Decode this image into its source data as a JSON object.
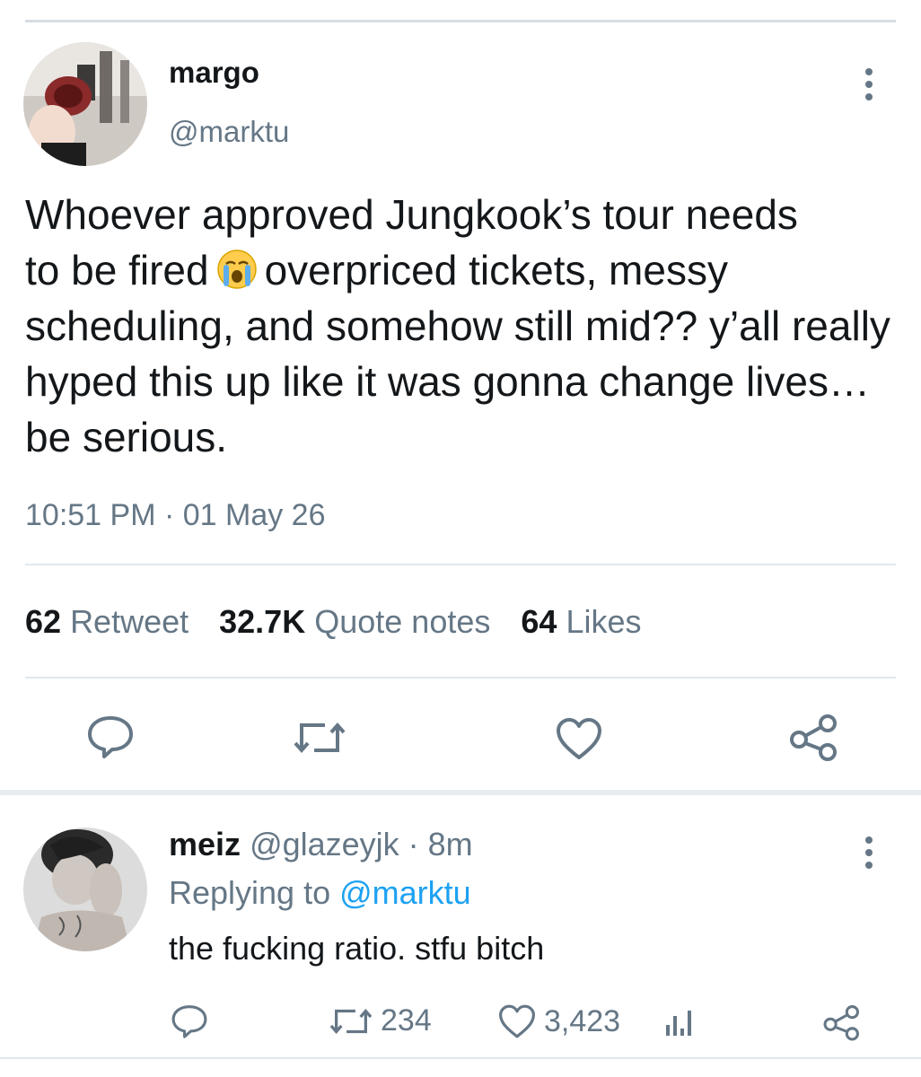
{
  "tweet": {
    "author_name": "margo",
    "author_handle": "@marktu",
    "text_line1": "Whoever approved Jungkook’s tour needs",
    "text_line2a": "to be fired",
    "text_line2b": "overpriced tickets, messy",
    "text_rest": "scheduling, and somehow still mid?? y’all really hyped this up like it was gonna change lives… be serious.",
    "emoji": "loudly-crying-face",
    "time": "10:51 PM · 01 May 26",
    "stats": {
      "retweets_count": "62",
      "retweets_label": "Retweet",
      "quotes_count": "32.7K",
      "quotes_label": "Quote notes",
      "likes_count": "64",
      "likes_label": "Likes"
    }
  },
  "reply": {
    "author_name": "meiz",
    "author_handle": "@glazeyjk · 8m",
    "replying_prefix": "Replying to",
    "replying_handle": "@marktu",
    "text": "the fucking ratio. stfu bitch",
    "retweets": "234",
    "likes": "3,423"
  },
  "colors": {
    "text": "#14171a",
    "muted": "#657786",
    "link": "#1da1f2",
    "divider": "#e1e8ed"
  }
}
